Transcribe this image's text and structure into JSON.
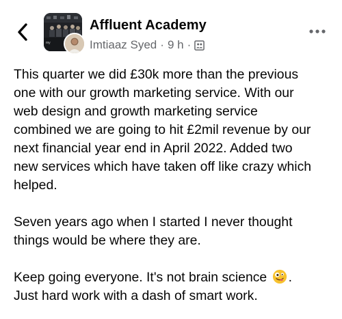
{
  "header": {
    "back_icon": "chevron-left-icon",
    "group_name": "Affluent Academy",
    "author": "Imtiaaz Syed",
    "separator": "·",
    "time_ago": "9 h",
    "audience_icon": "group-members-icon",
    "more_icon": "more-horizontal-icon"
  },
  "post": {
    "paragraph_1": "This quarter we did £30k more than the previous\none with our growth marketing service. With our\nweb design and growth marketing service\ncombined we are going to hit £2mil revenue by our\nnext financial year end in April 2022. Added two\nnew services which have taken off like crazy which\nhelped.",
    "paragraph_2": "Seven years ago when I started I never thought\nthings would be where they are.",
    "paragraph_3_before_emoji": "Keep going everyone. It's not brain science",
    "paragraph_3_emoji": "zany-face-emoji",
    "paragraph_3_after_emoji": ".\nJust hard work with a dash of smart work."
  },
  "colors": {
    "text": "#050505",
    "secondary_text": "#65676b",
    "emoji_yellow": "#f7c22f"
  }
}
